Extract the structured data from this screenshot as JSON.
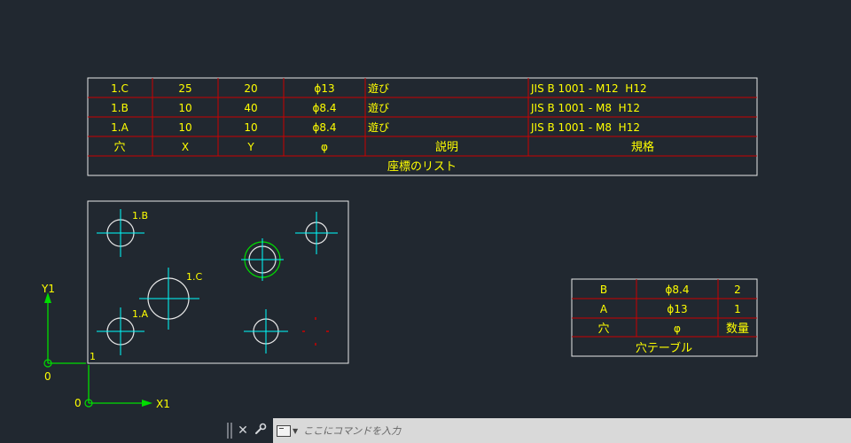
{
  "coord_table": {
    "title": "座標のリスト",
    "headers": [
      "穴",
      "X",
      "Y",
      "φ",
      "説明",
      "規格"
    ],
    "rows": [
      [
        "1.C",
        "25",
        "20",
        "ϕ13",
        "遊び",
        "JIS B 1001 - M12  H12"
      ],
      [
        "1.B",
        "10",
        "40",
        "ϕ8.4",
        "遊び",
        "JIS B 1001 - M8  H12"
      ],
      [
        "1.A",
        "10",
        "10",
        "ϕ8.4",
        "遊び",
        "JIS B 1001 - M8  H12"
      ]
    ]
  },
  "hole_table": {
    "title": "穴テーブル",
    "headers": [
      "穴",
      "φ",
      "数量"
    ],
    "rows": [
      [
        "B",
        "ϕ8.4",
        "2"
      ],
      [
        "A",
        "ϕ13",
        "1"
      ]
    ]
  },
  "hole_labels": {
    "b": "1.B",
    "c": "1.C",
    "a": "1.A"
  },
  "origin_label": "1",
  "ucs": {
    "y1": "Y1",
    "x1": "X1",
    "zero_top": "0",
    "zero_bottom": "0"
  },
  "colors": {
    "yellow": "#ffff00",
    "red": "#cc0000",
    "white": "#e8e8e8",
    "cyan": "#00ffff",
    "green": "#00dd00"
  },
  "command_bar": {
    "placeholder": "ここにコマンドを入力",
    "close_icon": "close-icon",
    "settings_icon": "wrench-icon",
    "prompt_icon": "command-prompt-icon"
  }
}
